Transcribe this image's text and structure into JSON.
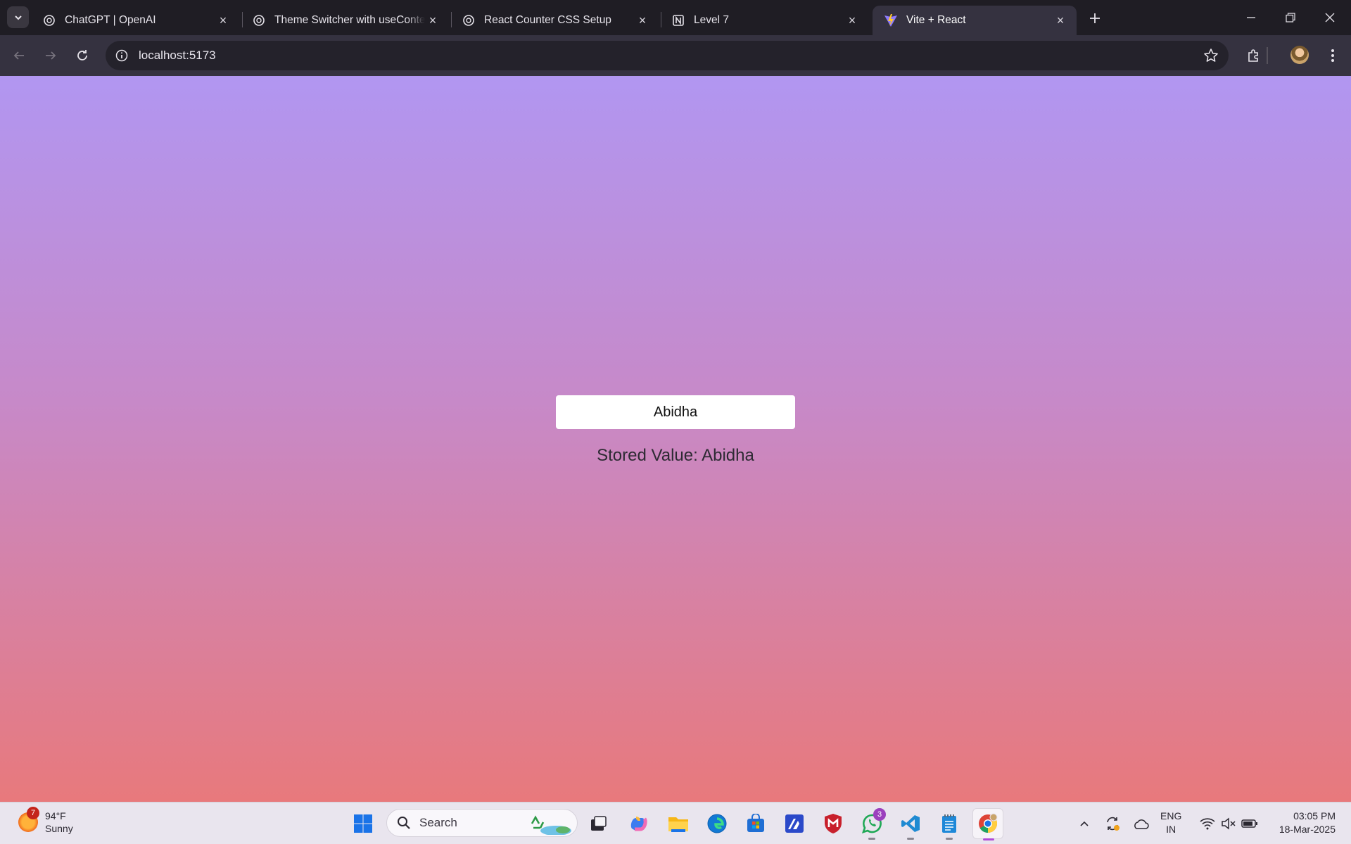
{
  "browser": {
    "tabs": [
      {
        "title": "ChatGPT | OpenAI",
        "icon": "openai-icon",
        "active": false
      },
      {
        "title": "Theme Switcher with useContext",
        "icon": "openai-icon",
        "active": false
      },
      {
        "title": "React Counter CSS Setup",
        "icon": "openai-icon",
        "active": false
      },
      {
        "title": "Level 7",
        "icon": "notion-icon",
        "active": false
      },
      {
        "title": "Vite + React",
        "icon": "vite-icon",
        "active": true
      }
    ],
    "url": "localhost:5173"
  },
  "page": {
    "input_value": "Abidha",
    "stored_text": "Stored Value: Abidha"
  },
  "taskbar": {
    "weather": {
      "temp": "94°F",
      "condition": "Sunny",
      "badge": "7"
    },
    "search_label": "Search",
    "whatsapp_badge": "3",
    "lang": {
      "line1": "ENG",
      "line2": "IN"
    },
    "clock": {
      "time": "03:05 PM",
      "date": "18-Mar-2025"
    }
  },
  "colors": {
    "page_gradient_top": "#b196f1",
    "page_gradient_bottom": "#e8797c",
    "browser_frame": "#1f1d24",
    "active_tab": "#353240"
  }
}
